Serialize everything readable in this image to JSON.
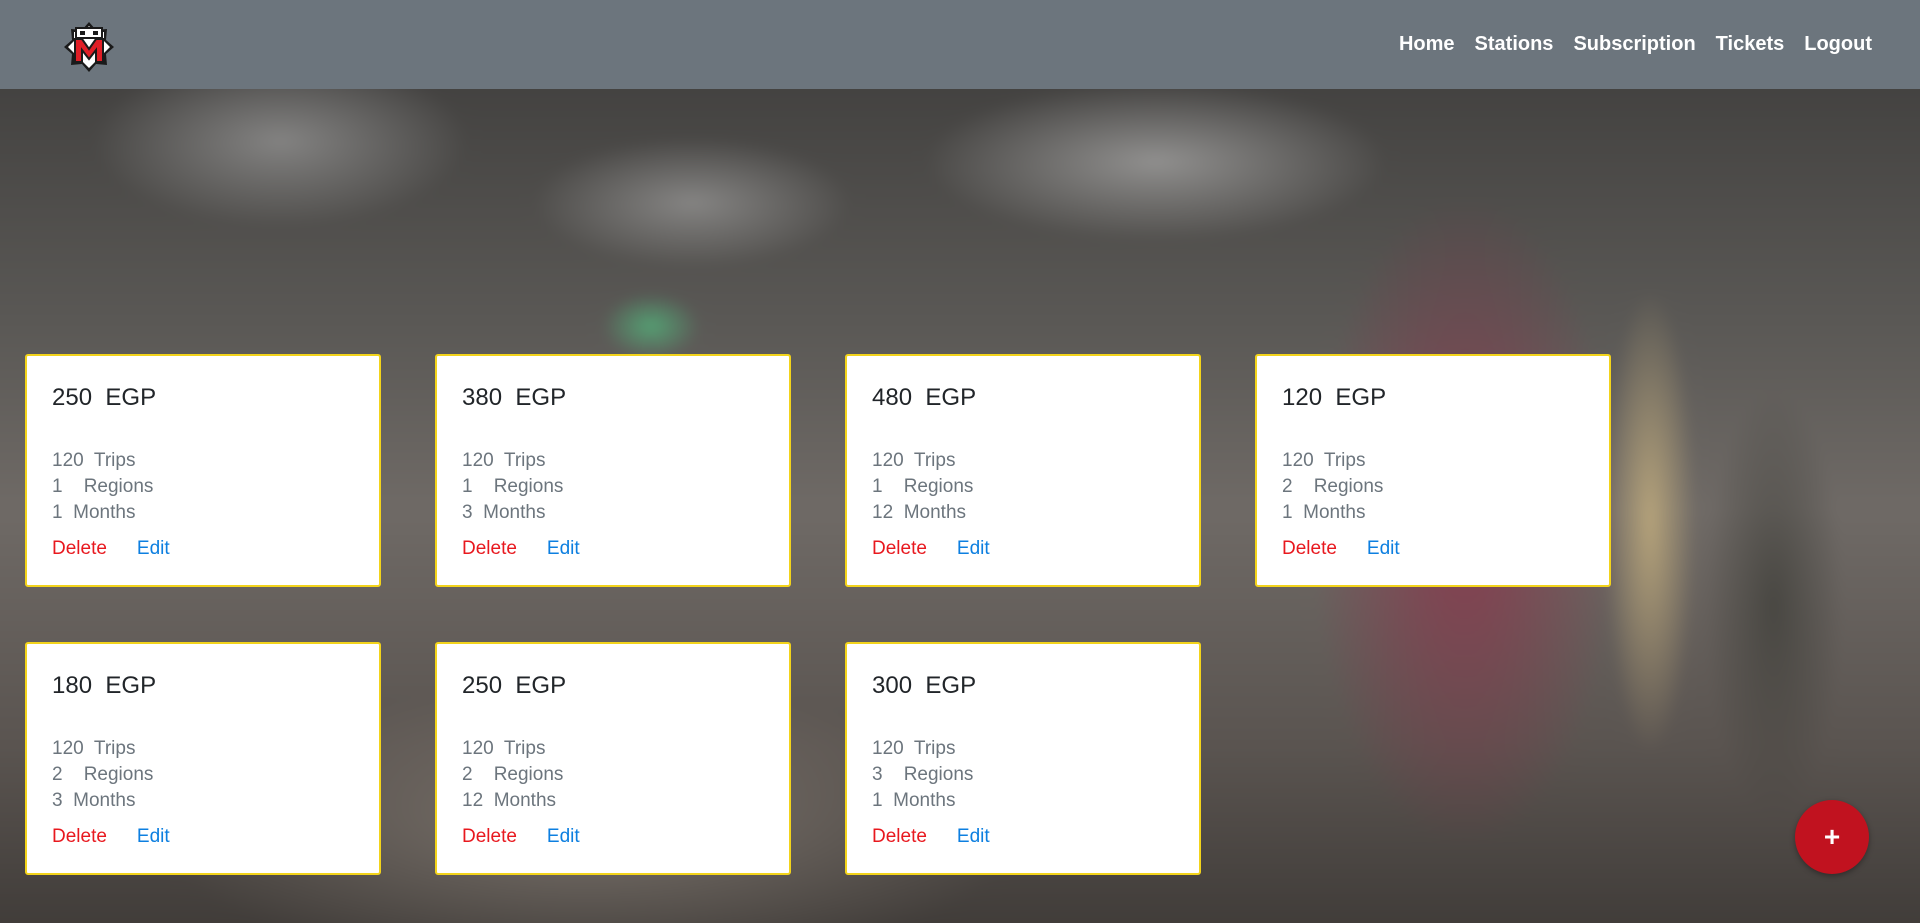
{
  "nav": {
    "links": [
      "Home",
      "Stations",
      "Subscription",
      "Tickets",
      "Logout"
    ]
  },
  "colors": {
    "navbar": "#6c757d",
    "card_border": "#f2d31b",
    "delete": "#e8181e",
    "edit": "#0d7fe0",
    "fab": "#c1121f"
  },
  "subscriptions": [
    {
      "price": "250",
      "currency": "EGP",
      "trips": "120",
      "trips_label": "Trips",
      "regions": "1",
      "regions_label": "Regions",
      "months": "1",
      "months_label": "Months",
      "delete_label": "Delete",
      "edit_label": "Edit"
    },
    {
      "price": "380",
      "currency": "EGP",
      "trips": "120",
      "trips_label": "Trips",
      "regions": "1",
      "regions_label": "Regions",
      "months": "3",
      "months_label": "Months",
      "delete_label": "Delete",
      "edit_label": "Edit"
    },
    {
      "price": "480",
      "currency": "EGP",
      "trips": "120",
      "trips_label": "Trips",
      "regions": "1",
      "regions_label": "Regions",
      "months": "12",
      "months_label": "Months",
      "delete_label": "Delete",
      "edit_label": "Edit"
    },
    {
      "price": "120",
      "currency": "EGP",
      "trips": "120",
      "trips_label": "Trips",
      "regions": "2",
      "regions_label": "Regions",
      "months": "1",
      "months_label": "Months",
      "delete_label": "Delete",
      "edit_label": "Edit"
    },
    {
      "price": "180",
      "currency": "EGP",
      "trips": "120",
      "trips_label": "Trips",
      "regions": "2",
      "regions_label": "Regions",
      "months": "3",
      "months_label": "Months",
      "delete_label": "Delete",
      "edit_label": "Edit"
    },
    {
      "price": "250",
      "currency": "EGP",
      "trips": "120",
      "trips_label": "Trips",
      "regions": "2",
      "regions_label": "Regions",
      "months": "12",
      "months_label": "Months",
      "delete_label": "Delete",
      "edit_label": "Edit"
    },
    {
      "price": "300",
      "currency": "EGP",
      "trips": "120",
      "trips_label": "Trips",
      "regions": "3",
      "regions_label": "Regions",
      "months": "1",
      "months_label": "Months",
      "delete_label": "Delete",
      "edit_label": "Edit"
    }
  ],
  "fab": {
    "icon": "plus-icon",
    "label": "+"
  }
}
